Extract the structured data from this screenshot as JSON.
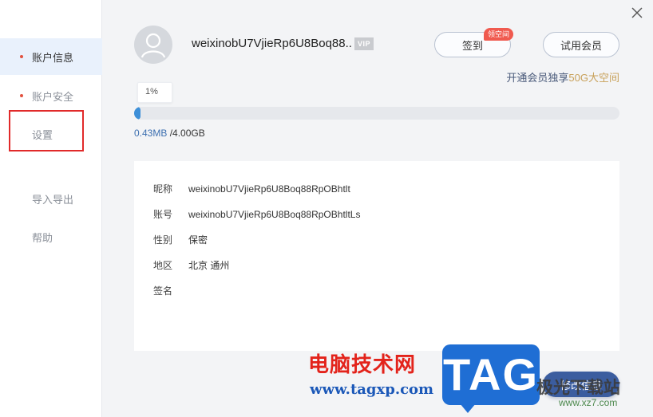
{
  "sidebar": {
    "items": [
      {
        "label": "账户信息"
      },
      {
        "label": "账户安全"
      },
      {
        "label": "设置"
      },
      {
        "label": "导入导出"
      },
      {
        "label": "帮助"
      }
    ]
  },
  "profile": {
    "username": "weixinobU7VjieRp6U8Boq88..",
    "vip_badge": "VIP"
  },
  "actions": {
    "checkin_label": "签到",
    "checkin_tag": "领空间",
    "trial_label": "试用会员",
    "edit_label": "修改信息"
  },
  "promo": {
    "prefix": "开通会员独享",
    "highlight": "50G大空间"
  },
  "storage": {
    "percent_label": "1%",
    "used_fraction": 0.01,
    "used": "0.43MB",
    "total": "/4.00GB"
  },
  "info": {
    "nickname_label": "昵称",
    "nickname": "weixinobU7VjieRp6U8Boq88RpOBhtlt",
    "account_label": "账号",
    "account": "weixinobU7VjieRp6U8Boq88RpOBhtltLs",
    "gender_label": "性别",
    "gender": "保密",
    "region_label": "地区",
    "region": "北京 通州",
    "signature_label": "签名",
    "signature": ""
  },
  "watermark": {
    "cn_text": "电脑技术网",
    "url": "www.tagxp.com",
    "tag": "TAG",
    "xz_text": "极光下载站",
    "xz_url": "www.xz7.com"
  },
  "colors": {
    "accent_blue": "#3b5d9f",
    "progress_blue": "#3d8fd8",
    "promo_gold": "#c8a15a",
    "tag_red": "#f05a4f",
    "highlight_red": "#e12a2a"
  }
}
